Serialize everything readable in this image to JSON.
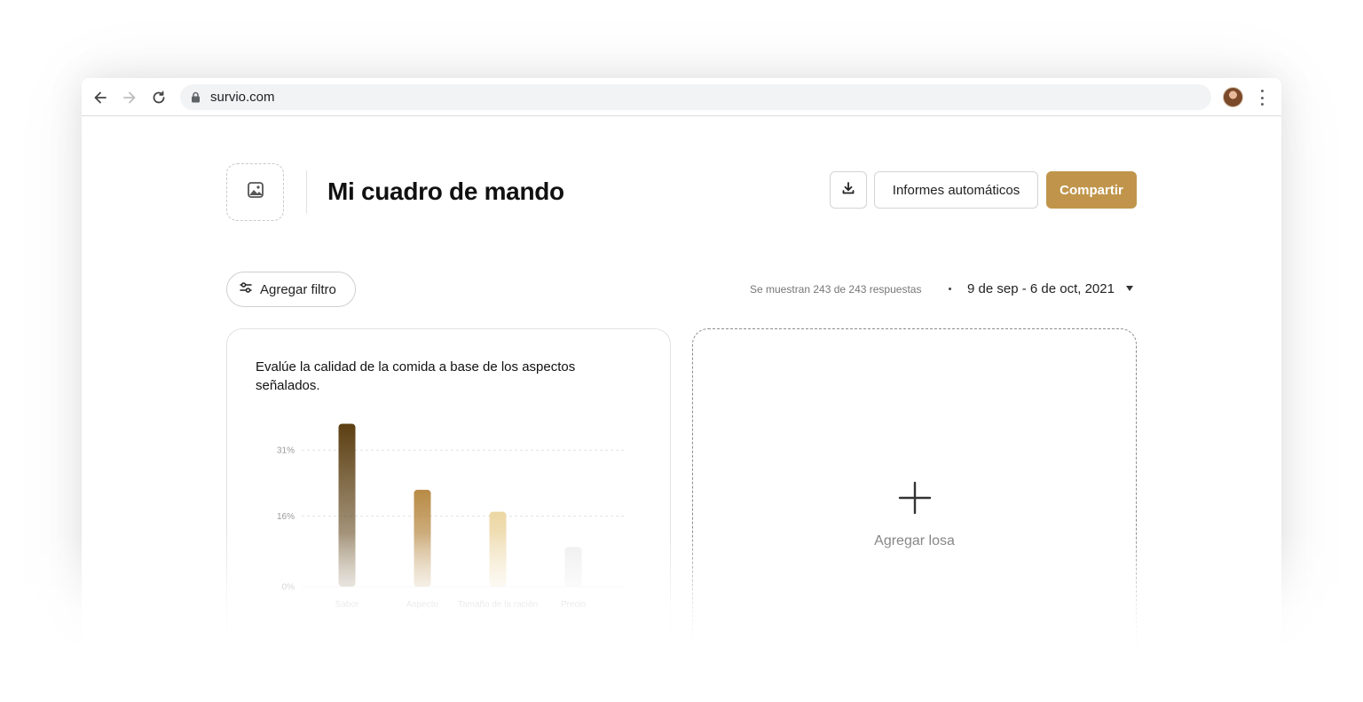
{
  "browser": {
    "url": "survio.com",
    "icons": {
      "back": "arrow-left-icon",
      "forward": "arrow-right-icon",
      "reload": "reload-icon",
      "lock": "lock-icon",
      "menu": "kebab-menu-icon"
    }
  },
  "header": {
    "title": "Mi cuadro de mando",
    "logo_icon": "image-icon",
    "download_icon": "download-icon",
    "reports_label": "Informes automáticos",
    "share_label": "Compartir"
  },
  "filters": {
    "add_filter_label": "Agregar filtro",
    "filter_icon": "sliders-icon",
    "responses_text": "Se muestran 243 de 243 respuestas",
    "date_range": "9 de sep - 6 de oct, 2021"
  },
  "card": {
    "title": "Evalúe la calidad de la comida a base de los aspectos señalados."
  },
  "chart_data": {
    "type": "bar",
    "categories": [
      "Sabor",
      "Aspecto",
      "Tamaño de la ración",
      "Precio"
    ],
    "values": [
      37,
      22,
      17,
      9
    ],
    "yticks": [
      "0%",
      "16%",
      "31%"
    ],
    "ytick_values": [
      0,
      16,
      31
    ],
    "ylim": [
      0,
      40
    ],
    "grid": true,
    "colors": [
      "#5c3f12",
      "#b88a45",
      "#ecd6a3",
      "#eeeeee"
    ]
  },
  "add_tile": {
    "label": "Agregar losa",
    "icon": "plus-icon"
  },
  "theme": {
    "accent": "#c0954b"
  }
}
